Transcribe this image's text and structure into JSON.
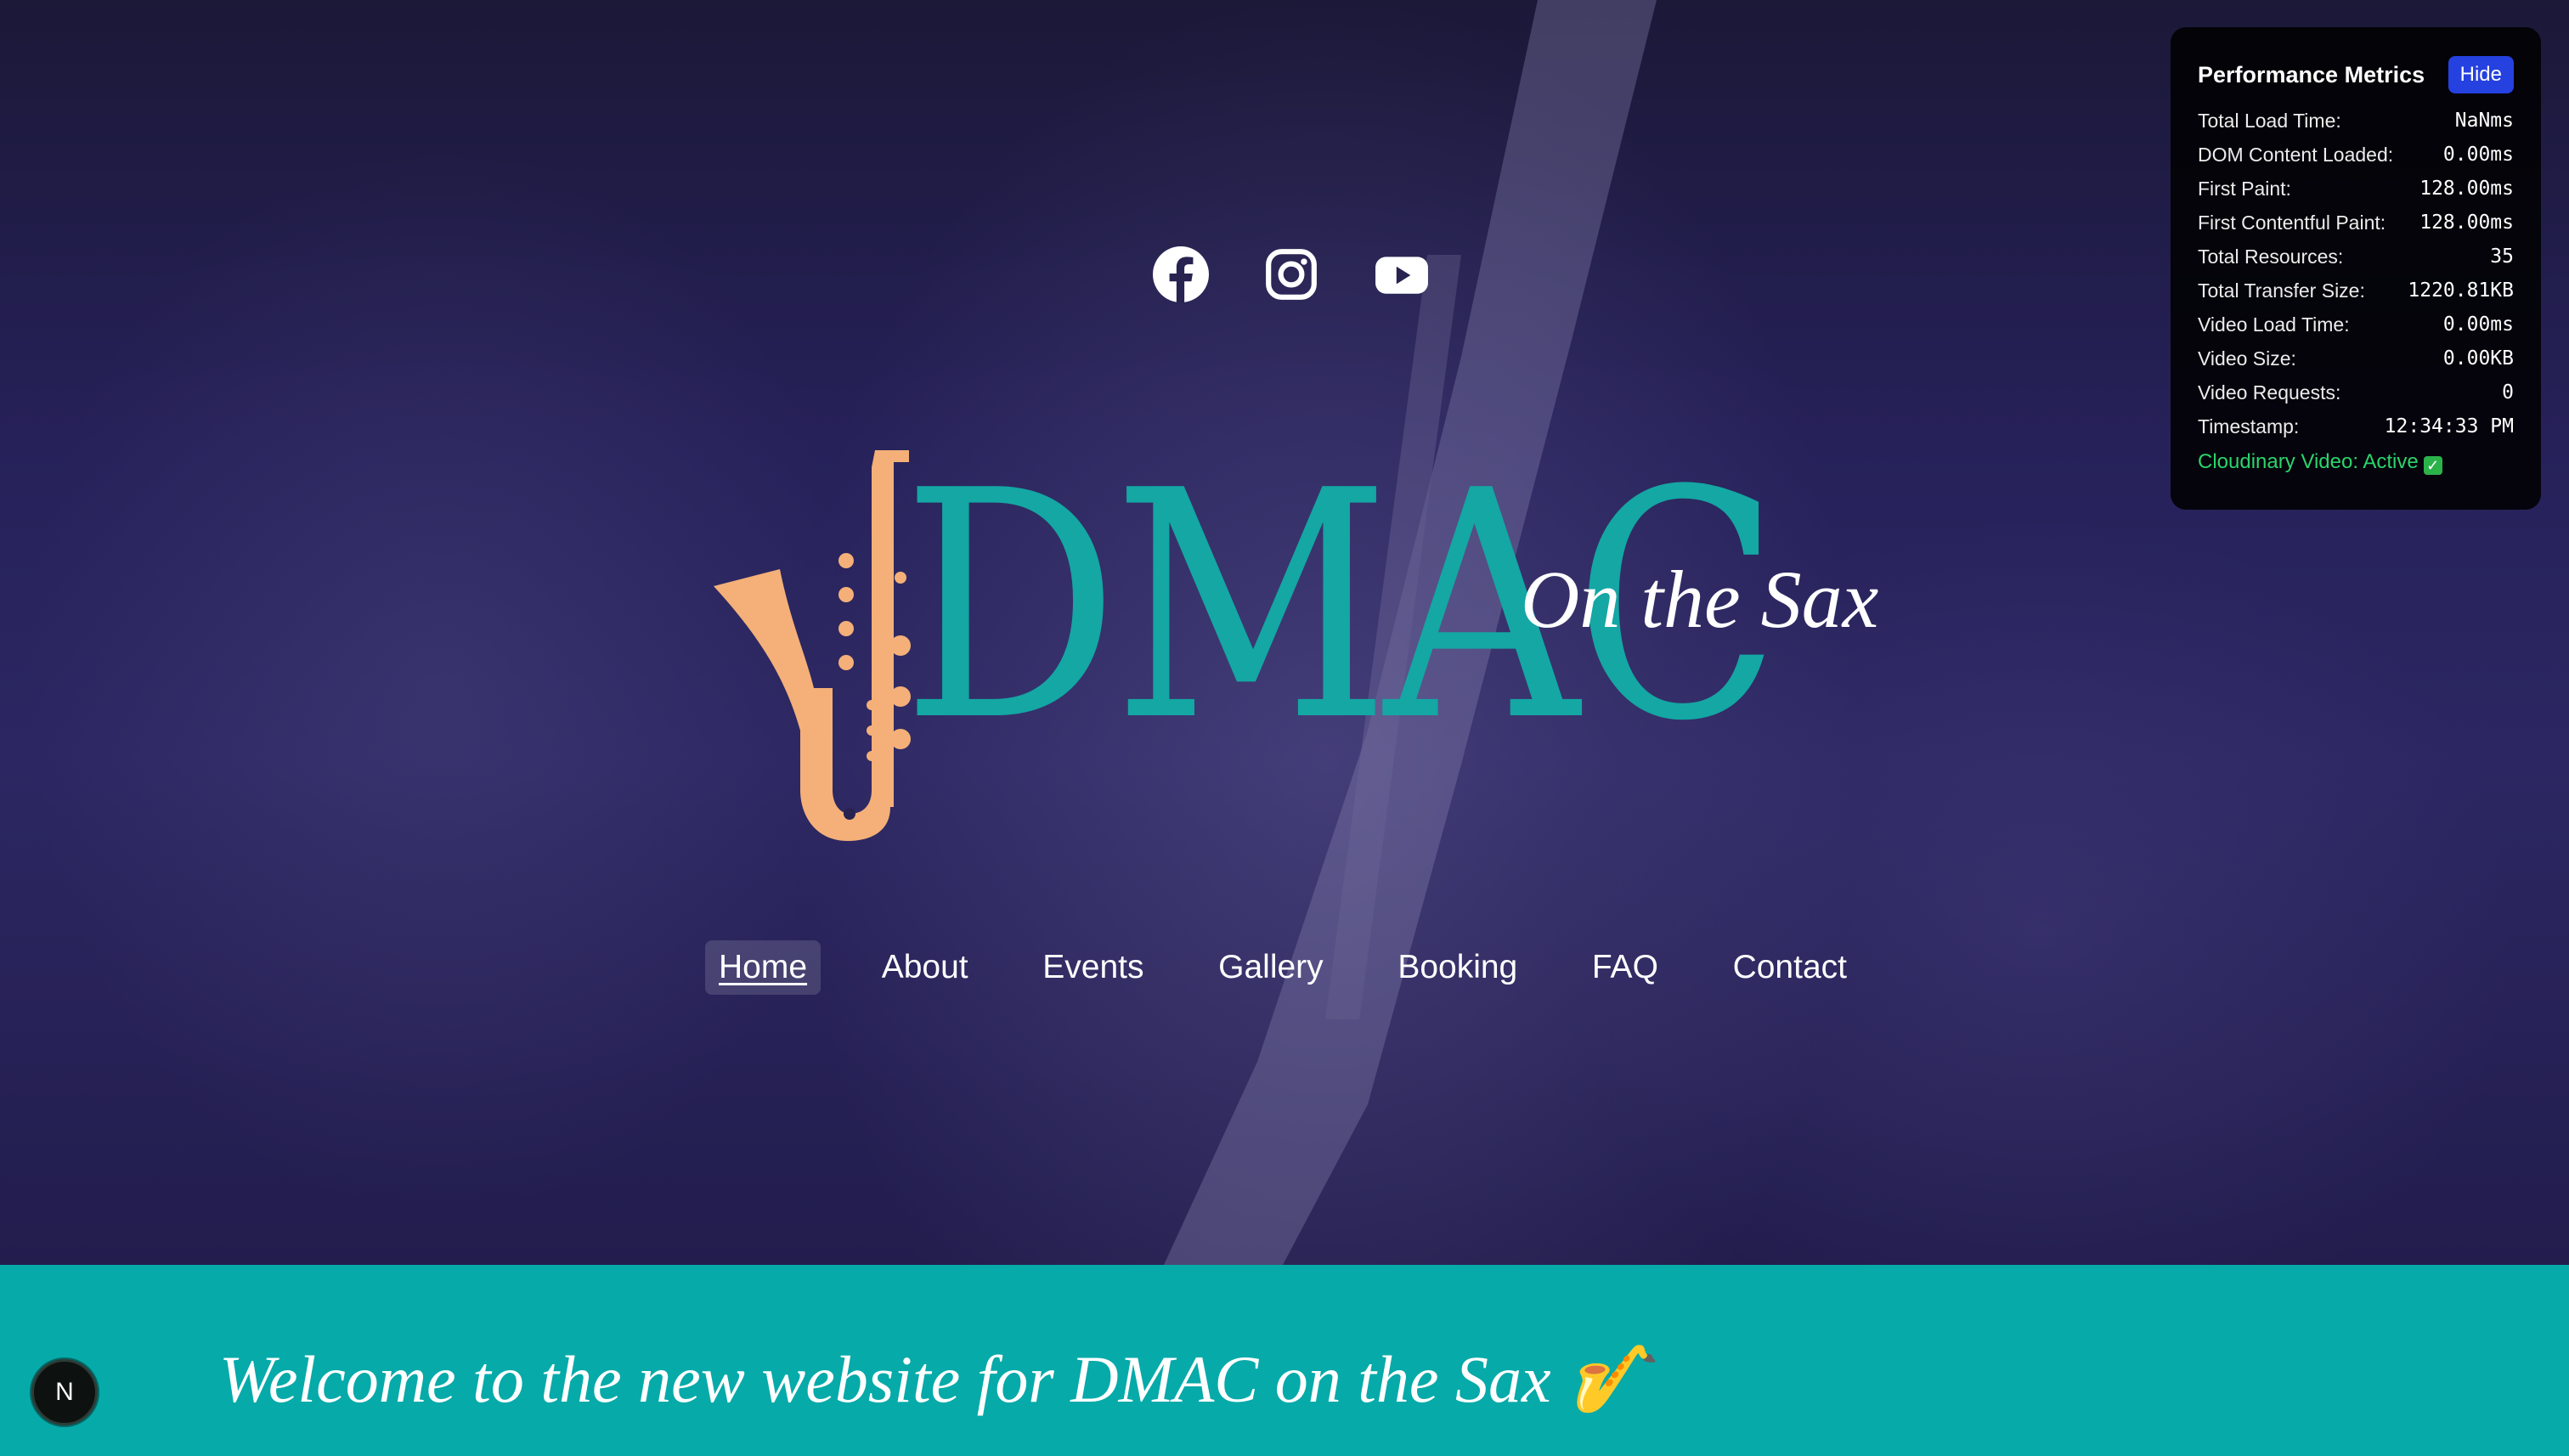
{
  "colors": {
    "brand_teal": "#14a7a4",
    "sax_orange": "#f4b078",
    "banner_teal": "#06aaa9",
    "hide_button": "#2541e0",
    "status_green": "#2bd46b"
  },
  "social": [
    {
      "name": "facebook-icon"
    },
    {
      "name": "instagram-icon"
    },
    {
      "name": "youtube-icon"
    }
  ],
  "logo": {
    "main": "DMAC",
    "sub": "On the Sax"
  },
  "nav": {
    "items": [
      {
        "label": "Home",
        "active": true
      },
      {
        "label": "About"
      },
      {
        "label": "Events"
      },
      {
        "label": "Gallery"
      },
      {
        "label": "Booking"
      },
      {
        "label": "FAQ"
      },
      {
        "label": "Contact"
      }
    ]
  },
  "banner": {
    "text": "Welcome to the new website for DMAC on the Sax 🎷"
  },
  "next_badge": {
    "label": "N"
  },
  "metrics": {
    "title": "Performance Metrics",
    "hide_label": "Hide",
    "rows": [
      {
        "label": "Total Load Time:",
        "value": "NaNms"
      },
      {
        "label": "DOM Content Loaded:",
        "value": "0.00ms"
      },
      {
        "label": "First Paint:",
        "value": "128.00ms"
      },
      {
        "label": "First Contentful Paint:",
        "value": "128.00ms"
      },
      {
        "label": "Total Resources:",
        "value": "35"
      },
      {
        "label": "Total Transfer Size:",
        "value": "1220.81KB"
      },
      {
        "label": "Video Load Time:",
        "value": "0.00ms"
      },
      {
        "label": "Video Size:",
        "value": "0.00KB"
      },
      {
        "label": "Video Requests:",
        "value": "0"
      },
      {
        "label": "Timestamp:",
        "value": "12:34:33 PM"
      }
    ],
    "status": "Cloudinary Video: Active"
  }
}
